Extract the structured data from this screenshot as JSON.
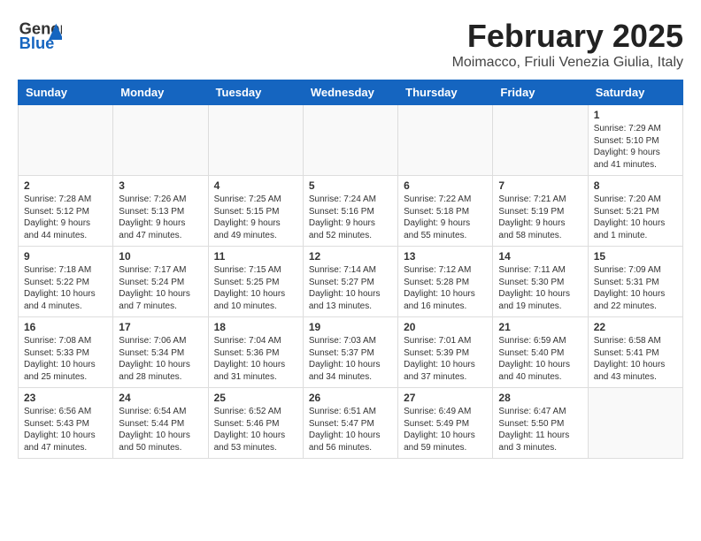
{
  "header": {
    "logo_general": "General",
    "logo_blue": "Blue",
    "title": "February 2025",
    "subtitle": "Moimacco, Friuli Venezia Giulia, Italy"
  },
  "weekdays": [
    "Sunday",
    "Monday",
    "Tuesday",
    "Wednesday",
    "Thursday",
    "Friday",
    "Saturday"
  ],
  "weeks": [
    [
      {
        "day": "",
        "info": ""
      },
      {
        "day": "",
        "info": ""
      },
      {
        "day": "",
        "info": ""
      },
      {
        "day": "",
        "info": ""
      },
      {
        "day": "",
        "info": ""
      },
      {
        "day": "",
        "info": ""
      },
      {
        "day": "1",
        "info": "Sunrise: 7:29 AM\nSunset: 5:10 PM\nDaylight: 9 hours and 41 minutes."
      }
    ],
    [
      {
        "day": "2",
        "info": "Sunrise: 7:28 AM\nSunset: 5:12 PM\nDaylight: 9 hours and 44 minutes."
      },
      {
        "day": "3",
        "info": "Sunrise: 7:26 AM\nSunset: 5:13 PM\nDaylight: 9 hours and 47 minutes."
      },
      {
        "day": "4",
        "info": "Sunrise: 7:25 AM\nSunset: 5:15 PM\nDaylight: 9 hours and 49 minutes."
      },
      {
        "day": "5",
        "info": "Sunrise: 7:24 AM\nSunset: 5:16 PM\nDaylight: 9 hours and 52 minutes."
      },
      {
        "day": "6",
        "info": "Sunrise: 7:22 AM\nSunset: 5:18 PM\nDaylight: 9 hours and 55 minutes."
      },
      {
        "day": "7",
        "info": "Sunrise: 7:21 AM\nSunset: 5:19 PM\nDaylight: 9 hours and 58 minutes."
      },
      {
        "day": "8",
        "info": "Sunrise: 7:20 AM\nSunset: 5:21 PM\nDaylight: 10 hours and 1 minute."
      }
    ],
    [
      {
        "day": "9",
        "info": "Sunrise: 7:18 AM\nSunset: 5:22 PM\nDaylight: 10 hours and 4 minutes."
      },
      {
        "day": "10",
        "info": "Sunrise: 7:17 AM\nSunset: 5:24 PM\nDaylight: 10 hours and 7 minutes."
      },
      {
        "day": "11",
        "info": "Sunrise: 7:15 AM\nSunset: 5:25 PM\nDaylight: 10 hours and 10 minutes."
      },
      {
        "day": "12",
        "info": "Sunrise: 7:14 AM\nSunset: 5:27 PM\nDaylight: 10 hours and 13 minutes."
      },
      {
        "day": "13",
        "info": "Sunrise: 7:12 AM\nSunset: 5:28 PM\nDaylight: 10 hours and 16 minutes."
      },
      {
        "day": "14",
        "info": "Sunrise: 7:11 AM\nSunset: 5:30 PM\nDaylight: 10 hours and 19 minutes."
      },
      {
        "day": "15",
        "info": "Sunrise: 7:09 AM\nSunset: 5:31 PM\nDaylight: 10 hours and 22 minutes."
      }
    ],
    [
      {
        "day": "16",
        "info": "Sunrise: 7:08 AM\nSunset: 5:33 PM\nDaylight: 10 hours and 25 minutes."
      },
      {
        "day": "17",
        "info": "Sunrise: 7:06 AM\nSunset: 5:34 PM\nDaylight: 10 hours and 28 minutes."
      },
      {
        "day": "18",
        "info": "Sunrise: 7:04 AM\nSunset: 5:36 PM\nDaylight: 10 hours and 31 minutes."
      },
      {
        "day": "19",
        "info": "Sunrise: 7:03 AM\nSunset: 5:37 PM\nDaylight: 10 hours and 34 minutes."
      },
      {
        "day": "20",
        "info": "Sunrise: 7:01 AM\nSunset: 5:39 PM\nDaylight: 10 hours and 37 minutes."
      },
      {
        "day": "21",
        "info": "Sunrise: 6:59 AM\nSunset: 5:40 PM\nDaylight: 10 hours and 40 minutes."
      },
      {
        "day": "22",
        "info": "Sunrise: 6:58 AM\nSunset: 5:41 PM\nDaylight: 10 hours and 43 minutes."
      }
    ],
    [
      {
        "day": "23",
        "info": "Sunrise: 6:56 AM\nSunset: 5:43 PM\nDaylight: 10 hours and 47 minutes."
      },
      {
        "day": "24",
        "info": "Sunrise: 6:54 AM\nSunset: 5:44 PM\nDaylight: 10 hours and 50 minutes."
      },
      {
        "day": "25",
        "info": "Sunrise: 6:52 AM\nSunset: 5:46 PM\nDaylight: 10 hours and 53 minutes."
      },
      {
        "day": "26",
        "info": "Sunrise: 6:51 AM\nSunset: 5:47 PM\nDaylight: 10 hours and 56 minutes."
      },
      {
        "day": "27",
        "info": "Sunrise: 6:49 AM\nSunset: 5:49 PM\nDaylight: 10 hours and 59 minutes."
      },
      {
        "day": "28",
        "info": "Sunrise: 6:47 AM\nSunset: 5:50 PM\nDaylight: 11 hours and 3 minutes."
      },
      {
        "day": "",
        "info": ""
      }
    ]
  ]
}
